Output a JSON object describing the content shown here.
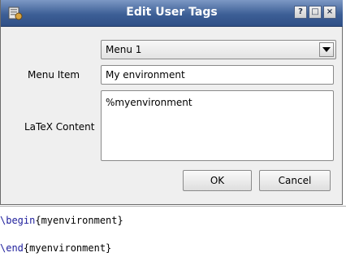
{
  "dialog": {
    "title": "Edit User Tags",
    "buttons": {
      "help": "?",
      "maximize": "□",
      "close": "×"
    },
    "menu_select": {
      "value": "Menu 1"
    },
    "menu_item": {
      "label": "Menu Item",
      "value": "My environment"
    },
    "latex_content": {
      "label": "LaTeX Content",
      "value": "%myenvironment"
    },
    "ok_label": "OK",
    "cancel_label": "Cancel"
  },
  "editor": {
    "line1": {
      "command": "\\begin",
      "arg": "{myenvironment}"
    },
    "line2": {
      "command": "\\end",
      "arg": "{myenvironment}"
    }
  },
  "colors": {
    "titlebar": "#3d5f96",
    "keyword": "#1d1d9b"
  }
}
